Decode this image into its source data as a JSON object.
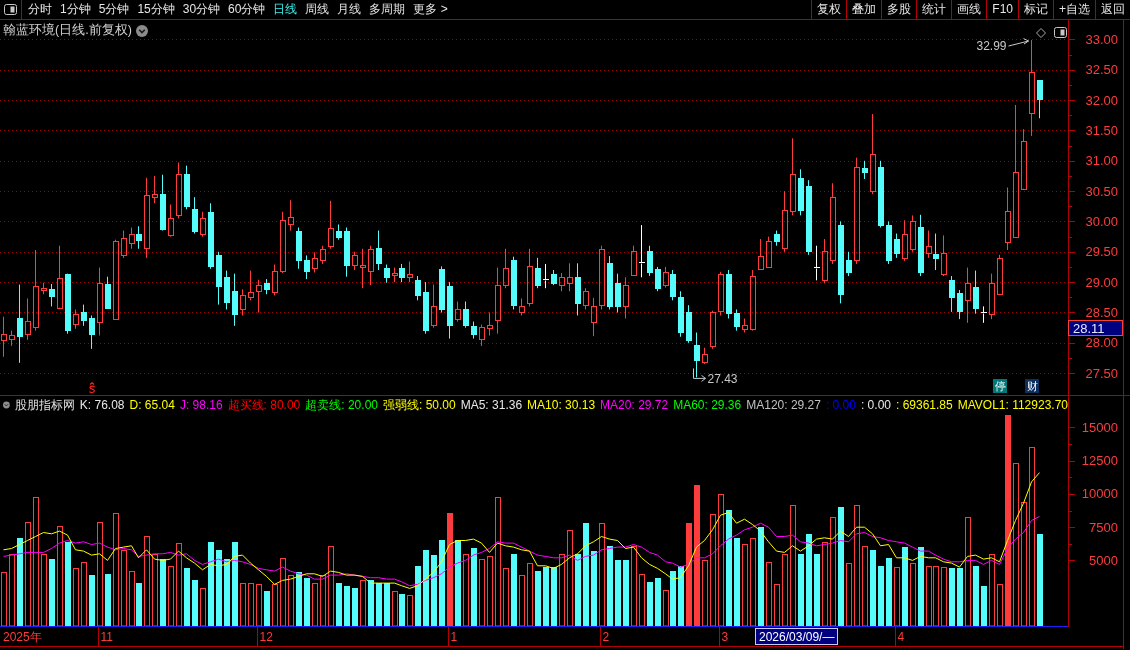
{
  "toolbar": {
    "tabs": [
      {
        "label": "分时",
        "selected": false
      },
      {
        "label": "1分钟",
        "selected": false
      },
      {
        "label": "5分钟",
        "selected": false
      },
      {
        "label": "15分钟",
        "selected": false
      },
      {
        "label": "30分钟",
        "selected": false
      },
      {
        "label": "60分钟",
        "selected": false
      },
      {
        "label": "日线",
        "selected": true
      },
      {
        "label": "周线",
        "selected": false
      },
      {
        "label": "月线",
        "selected": false
      },
      {
        "label": "多周期",
        "selected": false
      },
      {
        "label": "更多 >",
        "selected": false
      }
    ],
    "buttons": [
      "复权",
      "叠加",
      "多股",
      "统计",
      "画线",
      "F10",
      "标记",
      "+自选",
      "返回"
    ]
  },
  "price_pane": {
    "title": "翰蓝环境(日线.前复权)",
    "badges": [
      {
        "text": "停",
        "color": "#007878"
      },
      {
        "text": "财",
        "color": "#0c2f5e"
      }
    ],
    "chart_data": [
      {
        "type": "candlestick",
        "ylim": [
          27.14,
          33.32
        ],
        "yticks": [
          {
            "value": 27.5,
            "label": "27.50"
          },
          {
            "value": 28,
            "label": "28.00"
          },
          {
            "value": 28.5,
            "label": "28.50"
          },
          {
            "value": 29,
            "label": "29.00"
          },
          {
            "value": 29.5,
            "label": "29.50"
          },
          {
            "value": 30,
            "label": "30.00"
          },
          {
            "value": 30.5,
            "label": "30.50"
          },
          {
            "value": 31,
            "label": "31.00"
          },
          {
            "value": 31.5,
            "label": "31.50"
          },
          {
            "value": 32,
            "label": "32.00"
          },
          {
            "value": 32.5,
            "label": "32.50"
          },
          {
            "value": 33,
            "label": "33.00"
          }
        ],
        "grid": true,
        "annotations": [
          "32.99",
          "27.43"
        ],
        "ohlc": [
          [
            28.04,
            28.43,
            27.77,
            28.14
          ],
          [
            28.07,
            28.2,
            27.95,
            28.13
          ],
          [
            28.41,
            28.96,
            27.67,
            28.12
          ],
          [
            28.14,
            28.73,
            28.05,
            28.36
          ],
          [
            28.26,
            29.53,
            28.2,
            28.94
          ],
          [
            28.87,
            28.99,
            28.8,
            28.91
          ],
          [
            28.89,
            28.97,
            28.6,
            28.77
          ],
          [
            28.58,
            29.6,
            28.58,
            29.07
          ],
          [
            29.14,
            29.14,
            28.15,
            28.21
          ],
          [
            28.31,
            28.55,
            28.23,
            28.48
          ],
          [
            28.51,
            28.63,
            28.28,
            28.38
          ],
          [
            28.41,
            28.45,
            27.9,
            28.14
          ],
          [
            28.35,
            29.24,
            28.12,
            28.99
          ],
          [
            28.97,
            29.09,
            28.58,
            28.58
          ],
          [
            28.4,
            29.7,
            28.38,
            29.67
          ],
          [
            29.45,
            29.85,
            29.4,
            29.73
          ],
          [
            29.65,
            29.9,
            29.55,
            29.8
          ],
          [
            29.8,
            29.92,
            29.55,
            29.7
          ],
          [
            29.57,
            30.72,
            29.4,
            30.44
          ],
          [
            30.41,
            30.75,
            30.3,
            30.46
          ],
          [
            30.46,
            30.77,
            29.85,
            29.87
          ],
          [
            29.77,
            30.28,
            29.75,
            30.05
          ],
          [
            30.11,
            30.97,
            30.05,
            30.79
          ],
          [
            30.79,
            30.92,
            30.2,
            30.26
          ],
          [
            30.21,
            30.4,
            29.8,
            29.85
          ],
          [
            29.8,
            30.16,
            29.75,
            30.05
          ],
          [
            30.16,
            30.3,
            29.22,
            29.26
          ],
          [
            29.44,
            29.5,
            28.63,
            28.94
          ],
          [
            29.09,
            29.19,
            28.55,
            28.68
          ],
          [
            28.86,
            29.14,
            28.28,
            28.48
          ],
          [
            28.55,
            28.88,
            28.45,
            28.78
          ],
          [
            28.76,
            29.19,
            28.7,
            28.84
          ],
          [
            28.86,
            29.04,
            28.5,
            28.96
          ],
          [
            28.98,
            29.05,
            28.8,
            28.89
          ],
          [
            28.83,
            29.29,
            28.78,
            29.19
          ],
          [
            29.19,
            30.16,
            29.15,
            30.02
          ],
          [
            29.95,
            30.35,
            29.85,
            30.08
          ],
          [
            29.85,
            29.9,
            29.22,
            29.36
          ],
          [
            29.36,
            29.44,
            29.05,
            29.19
          ],
          [
            29.24,
            29.49,
            29.16,
            29.39
          ],
          [
            29.36,
            29.6,
            29.3,
            29.55
          ],
          [
            29.6,
            30.34,
            29.55,
            29.9
          ],
          [
            29.85,
            29.95,
            29.7,
            29.75
          ],
          [
            29.85,
            29.9,
            29.09,
            29.29
          ],
          [
            29.29,
            29.5,
            29.2,
            29.45
          ],
          [
            29.25,
            29.55,
            28.9,
            29.28
          ],
          [
            29.19,
            29.6,
            28.95,
            29.55
          ],
          [
            29.57,
            29.85,
            29.2,
            29.31
          ],
          [
            29.24,
            29.29,
            28.99,
            29.09
          ],
          [
            29.12,
            29.24,
            29.0,
            29.15
          ],
          [
            29.24,
            29.3,
            29.0,
            29.09
          ],
          [
            29.09,
            29.34,
            29.0,
            29.14
          ],
          [
            29.04,
            29.1,
            28.7,
            28.79
          ],
          [
            28.84,
            29.0,
            28.15,
            28.21
          ],
          [
            28.3,
            28.96,
            28.25,
            28.61
          ],
          [
            29.22,
            29.26,
            28.5,
            28.55
          ],
          [
            28.94,
            29.0,
            28.07,
            28.3
          ],
          [
            28.4,
            28.68,
            28.35,
            28.55
          ],
          [
            28.55,
            28.68,
            28.25,
            28.3
          ],
          [
            28.28,
            28.35,
            28.07,
            28.14
          ],
          [
            28.07,
            28.3,
            27.95,
            28.26
          ],
          [
            28.25,
            28.5,
            28.12,
            28.3
          ],
          [
            28.38,
            29.24,
            28.15,
            28.96
          ],
          [
            28.96,
            29.55,
            28.9,
            29.24
          ],
          [
            29.37,
            29.42,
            28.55,
            28.63
          ],
          [
            28.51,
            28.73,
            28.45,
            28.61
          ],
          [
            28.65,
            29.55,
            28.6,
            29.26
          ],
          [
            29.24,
            29.4,
            28.9,
            28.96
          ],
          [
            29.05,
            29.3,
            28.9,
            29.05
          ],
          [
            29.14,
            29.2,
            28.95,
            28.99
          ],
          [
            28.95,
            29.15,
            28.85,
            29.08
          ],
          [
            28.99,
            29.31,
            28.85,
            29.08
          ],
          [
            29.08,
            29.31,
            28.45,
            28.65
          ],
          [
            28.62,
            28.9,
            28.55,
            28.85
          ],
          [
            28.34,
            28.74,
            28.11,
            28.6
          ],
          [
            28.62,
            29.6,
            28.55,
            29.54
          ],
          [
            29.31,
            29.43,
            28.55,
            28.6
          ],
          [
            28.99,
            29.14,
            28.5,
            28.6
          ],
          [
            28.6,
            29.08,
            28.4,
            28.95
          ],
          [
            29.11,
            29.6,
            29.11,
            29.51
          ],
          [
            29.33,
            29.94,
            29.08,
            29.33
          ],
          [
            29.51,
            29.6,
            29.1,
            29.17
          ],
          [
            29.22,
            29.25,
            28.85,
            28.91
          ],
          [
            28.95,
            29.25,
            28.91,
            29.17
          ],
          [
            29.14,
            29.2,
            28.7,
            28.77
          ],
          [
            28.76,
            28.85,
            28.1,
            28.17
          ],
          [
            28.51,
            28.62,
            28.0,
            28.05
          ],
          [
            27.96,
            28.17,
            27.43,
            27.71
          ],
          [
            27.69,
            27.92,
            27.65,
            27.82
          ],
          [
            27.94,
            28.53,
            27.9,
            28.51
          ],
          [
            28.53,
            29.17,
            28.45,
            29.14
          ],
          [
            29.14,
            29.2,
            28.4,
            28.49
          ],
          [
            28.49,
            28.55,
            28.2,
            28.28
          ],
          [
            28.22,
            28.4,
            28.17,
            28.3
          ],
          [
            28.22,
            29.2,
            28.2,
            29.1
          ],
          [
            29.22,
            29.71,
            29.2,
            29.43
          ],
          [
            29.25,
            29.75,
            29.25,
            29.68
          ],
          [
            29.79,
            29.85,
            29.6,
            29.68
          ],
          [
            29.56,
            30.5,
            29.5,
            30.19
          ],
          [
            30.17,
            31.37,
            30.1,
            30.78
          ],
          [
            30.71,
            30.86,
            30.1,
            30.19
          ],
          [
            30.59,
            30.68,
            29.45,
            29.52
          ],
          [
            29.25,
            29.6,
            29.03,
            29.25
          ],
          [
            29.03,
            29.71,
            28.98,
            29.52
          ],
          [
            29.37,
            30.63,
            29.3,
            30.4
          ],
          [
            29.94,
            30.0,
            28.65,
            28.8
          ],
          [
            29.37,
            29.5,
            29.1,
            29.17
          ],
          [
            29.37,
            31.05,
            29.3,
            30.89
          ],
          [
            30.88,
            31.0,
            30.7,
            30.82
          ],
          [
            30.51,
            31.77,
            30.45,
            31.11
          ],
          [
            30.89,
            31.0,
            29.9,
            29.94
          ],
          [
            29.94,
            30.0,
            29.3,
            29.37
          ],
          [
            29.71,
            29.8,
            29.4,
            29.48
          ],
          [
            29.39,
            30.02,
            29.35,
            29.79
          ],
          [
            29.54,
            30.1,
            29.5,
            30.0
          ],
          [
            29.91,
            30.11,
            29.1,
            29.17
          ],
          [
            29.48,
            29.85,
            29.4,
            29.6
          ],
          [
            29.47,
            29.8,
            29.2,
            29.4
          ],
          [
            29.14,
            29.77,
            29.1,
            29.48
          ],
          [
            29.03,
            29.1,
            28.51,
            28.76
          ],
          [
            28.82,
            28.87,
            28.39,
            28.53
          ],
          [
            28.7,
            29.24,
            28.33,
            28.98
          ],
          [
            28.92,
            29.19,
            28.48,
            28.58
          ],
          [
            28.5,
            28.6,
            28.33,
            28.5
          ],
          [
            28.47,
            29.14,
            28.39,
            28.98
          ],
          [
            28.8,
            29.45,
            28.8,
            29.39
          ],
          [
            29.66,
            30.56,
            29.53,
            30.18
          ],
          [
            29.74,
            31.92,
            29.74,
            30.81
          ],
          [
            30.54,
            31.52,
            30.54,
            31.32
          ],
          [
            31.78,
            32.99,
            31.41,
            32.46
          ],
          [
            32.33,
            32.33,
            31.7,
            32.02
          ],
          null,
          null,
          null
        ]
      }
    ]
  },
  "cursor": {
    "price": "28.11",
    "date": "2026/03/09/—"
  },
  "indicator_pane": {
    "title": "股朋指标网",
    "readouts": [
      {
        "text": "K: 76.08",
        "color": "#e8e8e8"
      },
      {
        "text": "D: 65.04",
        "color": "#ffff00"
      },
      {
        "text": "J: 98.16",
        "color": "#ff00ff"
      },
      {
        "text": "超买线: 80.00",
        "color": "#ff0000"
      },
      {
        "text": "超卖线: 20.00",
        "color": "#00ff00"
      },
      {
        "text": "强弱线: 50.00",
        "color": "#ffff00"
      },
      {
        "text": "MA5: 31.36",
        "color": "#e8e8e8"
      },
      {
        "text": "MA10: 30.13",
        "color": "#ffff00"
      },
      {
        "text": "MA20: 29.72",
        "color": "#ff00ff"
      },
      {
        "text": "MA60: 29.36",
        "color": "#00ff00"
      },
      {
        "text": "MA120: 29.27",
        "color": "#c0c0c0"
      },
      {
        "text": ": 0.00",
        "color": "#0000ff"
      },
      {
        "text": ": 0.00",
        "color": "#e8e8e8"
      },
      {
        "text": ": 69361.85",
        "color": "#ffff00"
      },
      {
        "text": "MAVOL1: 112923.70",
        "color": "#ffff00"
      }
    ],
    "chart_data": [
      {
        "type": "bar",
        "ylim": [
          0,
          16000
        ],
        "yticks": [
          5000,
          7500,
          10000,
          12500,
          15000
        ],
        "series": [
          {
            "type": "bar",
            "color": "#ff3c3c",
            "values": [
              4100,
              5500,
              null,
              7900,
              9800,
              5500,
              null,
              7600,
              null,
              4400,
              4900,
              null,
              7900,
              null,
              8600,
              5800,
              4200,
              null,
              6800,
              5500,
              null,
              4600,
              6300,
              null,
              null,
              2900,
              null,
              null,
              null,
              null,
              3300,
              3300,
              3200,
              null,
              3200,
              5200,
              3900,
              null,
              null,
              3300,
              3900,
              6100,
              null,
              null,
              null,
              3500,
              null,
              null,
              null,
              2700,
              null,
              2400,
              null,
              null,
              null,
              null,
              null,
              null,
              5500,
              null,
              5100,
              5300,
              9800,
              4400,
              null,
              3900,
              4800,
              null,
              null,
              null,
              5500,
              7300,
              null,
              null,
              null,
              7800,
              null,
              null,
              null,
              6100,
              4000,
              null,
              null,
              2800,
              null,
              null,
              null,
              null,
              5000,
              8500,
              10000,
              null,
              null,
              6200,
              6700,
              null,
              4900,
              3200,
              5500,
              9200,
              null,
              null,
              null,
              6400,
              8300,
              null,
              4800,
              9200,
              6100,
              null,
              null,
              null,
              4500,
              null,
              4800,
              null,
              4600,
              4600,
              4500,
              null,
              null,
              8300,
              null,
              null,
              5500,
              3200,
              null,
              12300,
              9400,
              13500,
              null,
              null,
              null,
              null
            ]
          },
          {
            "type": "bar",
            "values": [
              null,
              null,
              6700,
              null,
              null,
              null,
              5100,
              null,
              6400,
              null,
              null,
              3900,
              null,
              4000,
              null,
              null,
              null,
              3300,
              null,
              null,
              5100,
              null,
              null,
              4400,
              3500,
              null,
              6400,
              5800,
              5100,
              6400,
              null,
              null,
              null,
              2700,
              null,
              null,
              null,
              4100,
              3700,
              null,
              null,
              null,
              3300,
              3100,
              2900,
              null,
              3500,
              3300,
              3300,
              null,
              2500,
              null,
              4600,
              5800,
              5400,
              6500,
              8600,
              6500,
              null,
              5900,
              null,
              null,
              null,
              null,
              5500,
              null,
              null,
              4200,
              4500,
              4500,
              null,
              null,
              5500,
              7800,
              5700,
              null,
              6100,
              5000,
              5000,
              null,
              null,
              3400,
              3700,
              null,
              4200,
              4600,
              7800,
              10700,
              null,
              null,
              null,
              8800,
              6700,
              null,
              null,
              7500,
              null,
              null,
              null,
              null,
              5500,
              7000,
              5500,
              null,
              null,
              9000,
              null,
              null,
              null,
              5800,
              4600,
              5200,
              null,
              6000,
              null,
              6000,
              null,
              null,
              null,
              4400,
              4400,
              null,
              4600,
              3100,
              null,
              null,
              15900,
              null,
              null,
              null,
              7000,
              null,
              null,
              null
            ],
            "colors": [
              null,
              null,
              "#54fcfc",
              null,
              null,
              null,
              "#54fcfc",
              null,
              "#54fcfc",
              null,
              null,
              "#54fcfc",
              null,
              "#54fcfc",
              null,
              null,
              null,
              "#54fcfc",
              null,
              null,
              "#54fcfc",
              null,
              null,
              "#54fcfc",
              "#54fcfc",
              null,
              "#54fcfc",
              "#54fcfc",
              "#54fcfc",
              "#54fcfc",
              null,
              null,
              null,
              "#54fcfc",
              null,
              null,
              null,
              "#54fcfc",
              "#54fcfc",
              null,
              null,
              null,
              "#54fcfc",
              "#54fcfc",
              "#54fcfc",
              null,
              "#54fcfc",
              "#54fcfc",
              "#54fcfc",
              null,
              "#54fcfc",
              null,
              "#54fcfc",
              "#54fcfc",
              "#54fcfc",
              "#54fcfc",
              "#ff3c3c",
              "#54fcfc",
              null,
              "#54fcfc",
              null,
              null,
              null,
              null,
              "#54fcfc",
              null,
              null,
              "#54fcfc",
              "#54fcfc",
              "#54fcfc",
              null,
              null,
              "#54fcfc",
              "#54fcfc",
              "#54fcfc",
              null,
              "#54fcfc",
              "#54fcfc",
              "#54fcfc",
              null,
              null,
              "#54fcfc",
              "#54fcfc",
              null,
              "#54fcfc",
              "#54fcfc",
              "#ff3c3c",
              "#ff3c3c",
              null,
              null,
              null,
              "#54fcfc",
              "#54fcfc",
              null,
              null,
              "#54fcfc",
              null,
              null,
              null,
              null,
              "#54fcfc",
              "#54fcfc",
              "#54fcfc",
              null,
              null,
              "#54fcfc",
              null,
              null,
              null,
              "#54fcfc",
              "#54fcfc",
              "#54fcfc",
              null,
              "#54fcfc",
              null,
              "#54fcfc",
              null,
              null,
              null,
              "#54fcfc",
              "#54fcfc",
              null,
              "#54fcfc",
              "#54fcfc",
              null,
              null,
              "#ff3c3c",
              null,
              null,
              null,
              "#54fcfc",
              null,
              null,
              null
            ]
          },
          {
            "type": "line",
            "color": "#ff00ff",
            "values": [
              5300,
              5400,
              5500,
              5600,
              5600,
              5600,
              5900,
              6300,
              6500,
              6300,
              6400,
              6200,
              6300,
              6000,
              5800,
              5900,
              5800,
              5300,
              5400,
              5500,
              5500,
              5600,
              5400,
              5500,
              5000,
              4700,
              4900,
              5100,
              4900,
              5000,
              4900,
              4700,
              4400,
              4300,
              4200,
              4500,
              4200,
              4000,
              3900,
              3600,
              3600,
              3900,
              3900,
              4000,
              3900,
              3800,
              3700,
              3700,
              3600,
              3600,
              3400,
              3100,
              3200,
              3500,
              3700,
              4000,
              4500,
              4800,
              5000,
              5400,
              5600,
              5900,
              6400,
              6300,
              6300,
              6000,
              5700,
              5400,
              5300,
              5200,
              5200,
              5400,
              5000,
              5300,
              5400,
              5800,
              5900,
              6000,
              6000,
              6200,
              6000,
              5600,
              5400,
              4900,
              4800,
              4500,
              4700,
              5200,
              5200,
              5500,
              6100,
              6600,
              6900,
              7300,
              7500,
              7800,
              7500,
              6800,
              6800,
              6900,
              6400,
              6300,
              6100,
              6200,
              6300,
              6500,
              6400,
              7000,
              7100,
              6800,
              6700,
              6500,
              6400,
              6300,
              6000,
              5700,
              5700,
              5400,
              5100,
              4900,
              4900,
              5000,
              5000,
              4700,
              5000,
              4700,
              5900,
              6600,
              7100,
              8000,
              8300,
              null,
              null,
              null
            ]
          },
          {
            "type": "line",
            "color": "#ffff00",
            "values": [
              5800,
              5900,
              6200,
              6500,
              6800,
              7100,
              7000,
              7200,
              6900,
              5800,
              5700,
              5400,
              5500,
              5000,
              5900,
              6000,
              6100,
              5200,
              5800,
              5100,
              5000,
              5100,
              5700,
              5200,
              4800,
              4300,
              4700,
              4600,
              4700,
              5300,
              5400,
              4800,
              4300,
              3800,
              3200,
              3500,
              3600,
              3800,
              4000,
              4000,
              3800,
              4200,
              4100,
              3900,
              3900,
              3800,
              3300,
              3300,
              3300,
              3300,
              3100,
              2900,
              3100,
              3600,
              4100,
              4900,
              6200,
              6500,
              6500,
              6600,
              6300,
              5600,
              6300,
              6100,
              6000,
              5800,
              5700,
              4600,
              4600,
              4400,
              4700,
              5200,
              5500,
              6100,
              6400,
              6800,
              6600,
              6500,
              5900,
              6000,
              5200,
              4700,
              4400,
              4000,
              3600,
              3700,
              4600,
              6000,
              6500,
              7300,
              8400,
              8600,
              7800,
              8100,
              7700,
              7200,
              6400,
              5700,
              5600,
              6100,
              5700,
              6100,
              6600,
              6700,
              6600,
              7200,
              6800,
              7500,
              7500,
              7000,
              6100,
              6200,
              5200,
              5200,
              5000,
              5300,
              5200,
              5200,
              4900,
              4800,
              4500,
              5300,
              5400,
              5100,
              5200,
              4900,
              6500,
              8000,
              9300,
              10900,
              11600,
              null,
              null,
              null
            ]
          }
        ]
      }
    ]
  },
  "date_axis": {
    "labels": [
      "2025年",
      "11",
      "12",
      "1",
      "2",
      "3",
      "4"
    ]
  }
}
